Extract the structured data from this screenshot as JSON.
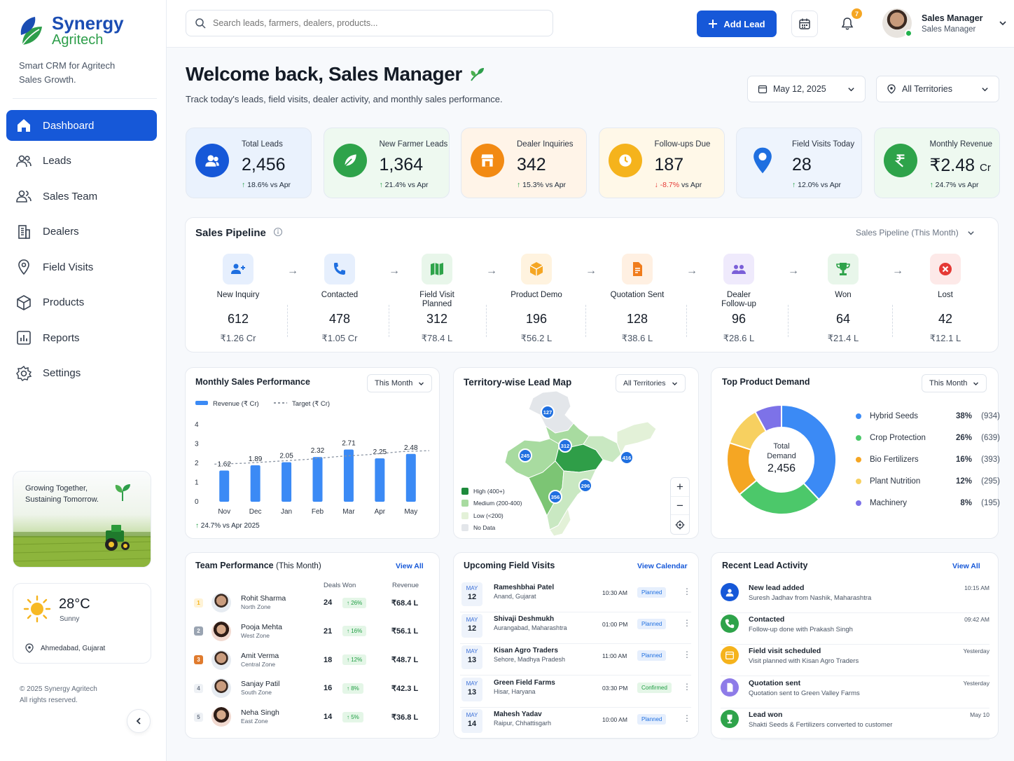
{
  "brand": {
    "name": "Synergy",
    "name2": "Agritech",
    "tagline": "Smart CRM for Agritech Sales Growth."
  },
  "nav": [
    {
      "label": "Dashboard",
      "icon": "home-icon",
      "active": true
    },
    {
      "label": "Leads",
      "icon": "users-icon"
    },
    {
      "label": "Sales Team",
      "icon": "team-icon"
    },
    {
      "label": "Dealers",
      "icon": "building-icon"
    },
    {
      "label": "Field Visits",
      "icon": "location-pin-icon"
    },
    {
      "label": "Products",
      "icon": "box-icon"
    },
    {
      "label": "Reports",
      "icon": "chart-icon"
    },
    {
      "label": "Settings",
      "icon": "gear-icon"
    }
  ],
  "promo": {
    "line1": "Growing Together,",
    "line2": "Sustaining Tomorrow."
  },
  "weather": {
    "temp": "28°C",
    "condition": "Sunny",
    "location": "Ahmedabad, Gujarat"
  },
  "footer": {
    "copyright": "© 2025 Synergy Agritech",
    "rights": "All rights reserved."
  },
  "topbar": {
    "search_placeholder": "Search leads, farmers, dealers, products...",
    "add_lead": "Add Lead",
    "notif_count": "7",
    "user_name": "Sales Manager",
    "user_role": "Sales Manager"
  },
  "header": {
    "title": "Welcome back, Sales Manager",
    "subtitle": "Track today's leads, field visits, dealer activity, and monthly sales performance.",
    "date": "May 12, 2025",
    "territory": "All Territories"
  },
  "kpis": [
    {
      "label": "Total Leads",
      "value": "2,456",
      "delta": "18.6%",
      "dir": "up",
      "vs": "vs Apr",
      "color": "#1658d8",
      "bg": "#eaf2fd",
      "icon": "users-icon"
    },
    {
      "label": "New Farmer Leads",
      "value": "1,364",
      "delta": "21.4%",
      "dir": "up",
      "vs": "vs Apr",
      "color": "#2ea34a",
      "bg": "#eef9f0",
      "icon": "leaf-icon"
    },
    {
      "label": "Dealer Inquiries",
      "value": "342",
      "delta": "15.3%",
      "dir": "up",
      "vs": "vs Apr",
      "color": "#f28a13",
      "bg": "#fff4e8",
      "icon": "store-icon"
    },
    {
      "label": "Follow-ups Due",
      "value": "187",
      "delta": "-8.7%",
      "dir": "down",
      "vs": "vs Apr",
      "color": "#f5b31c",
      "bg": "#fff8e8",
      "icon": "clock-icon"
    },
    {
      "label": "Field Visits Today",
      "value": "28",
      "delta": "12.0%",
      "dir": "up",
      "vs": "vs Apr",
      "color": "#1f6fe0",
      "bg": "#eef4fd",
      "icon": "location-pin-icon"
    },
    {
      "label": "Monthly Revenue",
      "value": "₹2.48",
      "unit": "Cr",
      "delta": "24.7%",
      "dir": "up",
      "vs": "vs Apr",
      "color": "#2ea34a",
      "bg": "#eef9f0",
      "icon": "rupee-icon"
    }
  ],
  "pipeline": {
    "title": "Sales Pipeline",
    "filter": "Sales Pipeline (This Month)",
    "stages": [
      {
        "name": "New Inquiry",
        "count": "612",
        "value": "₹1.26 Cr",
        "color": "#1f6fe0",
        "bg": "#e6effd",
        "icon": "add-user-icon"
      },
      {
        "name": "Contacted",
        "count": "478",
        "value": "₹1.05 Cr",
        "color": "#1f6fe0",
        "bg": "#e6effd",
        "icon": "phone-icon"
      },
      {
        "name": "Field Visit Planned",
        "count": "312",
        "value": "₹78.4 L",
        "color": "#2ea34a",
        "bg": "#e8f6ea",
        "icon": "map-icon"
      },
      {
        "name": "Product Demo",
        "count": "196",
        "value": "₹56.2 L",
        "color": "#f5a623",
        "bg": "#fff3df",
        "icon": "cube-icon"
      },
      {
        "name": "Quotation Sent",
        "count": "128",
        "value": "₹38.6 L",
        "color": "#f07c1c",
        "bg": "#fff0e2",
        "icon": "document-icon"
      },
      {
        "name": "Dealer Follow-up",
        "count": "96",
        "value": "₹28.6 L",
        "color": "#7a5fd8",
        "bg": "#efeafc",
        "icon": "group-icon"
      },
      {
        "name": "Won",
        "count": "64",
        "value": "₹21.4 L",
        "color": "#2ea34a",
        "bg": "#e8f6ea",
        "icon": "trophy-icon"
      },
      {
        "name": "Lost",
        "count": "42",
        "value": "₹12.1 L",
        "color": "#e53935",
        "bg": "#fde9e8",
        "icon": "close-circle-icon"
      }
    ]
  },
  "monthly": {
    "title": "Monthly Sales Performance",
    "filter": "This Month",
    "growth": "24.7% vs Apr 2025"
  },
  "chart_data": {
    "type": "bar",
    "categories": [
      "Nov",
      "Dec",
      "Jan",
      "Feb",
      "Mar",
      "Apr",
      "May"
    ],
    "series": [
      {
        "name": "Revenue (₹ Cr)",
        "values": [
          1.62,
          1.89,
          2.05,
          2.32,
          2.71,
          2.25,
          2.48
        ],
        "labels": [
          "1.62",
          "1.89",
          "2.05",
          "2.32",
          "2.71",
          "2.25",
          "2.48"
        ],
        "color": "#3b8af5"
      },
      {
        "name": "Target (₹ Cr)",
        "values": [
          1.95,
          2.0,
          2.1,
          2.2,
          2.35,
          2.45,
          2.6
        ],
        "style": "dashed",
        "color": "#8a94a3"
      }
    ],
    "yticks": [
      "0",
      "1",
      "2",
      "3",
      "4"
    ],
    "ylim": [
      0,
      4
    ],
    "legend": "top-left"
  },
  "map": {
    "title": "Territory-wise Lead Map",
    "filter": "All Territories",
    "legend": [
      {
        "label": "High (400+)",
        "color": "#1e8a3c"
      },
      {
        "label": "Medium (200-400)",
        "color": "#a8dba0"
      },
      {
        "label": "Low (<200)",
        "color": "#e3f1d8"
      },
      {
        "label": "No Data",
        "color": "#e3e6ea"
      }
    ],
    "markers": [
      "127",
      "312",
      "245",
      "416",
      "296",
      "356"
    ]
  },
  "demand": {
    "title": "Top Product Demand",
    "filter": "This Month",
    "center_label": "Total Demand",
    "center_value": "2,456",
    "items": [
      {
        "name": "Hybrid Seeds",
        "pct": "38%",
        "count": "(934)",
        "color": "#3b8af5",
        "value": 38
      },
      {
        "name": "Crop Protection",
        "pct": "26%",
        "count": "(639)",
        "color": "#4cc86a",
        "value": 26
      },
      {
        "name": "Bio Fertilizers",
        "pct": "16%",
        "count": "(393)",
        "color": "#f5a623",
        "value": 16
      },
      {
        "name": "Plant Nutrition",
        "pct": "12%",
        "count": "(295)",
        "color": "#f7d060",
        "value": 12
      },
      {
        "name": "Machinery",
        "pct": "8%",
        "count": "(195)",
        "color": "#7d72e8",
        "value": 8
      }
    ]
  },
  "team": {
    "title": "Team Performance",
    "period": "(This Month)",
    "view_all": "View All",
    "col_deals": "Deals Won",
    "col_revenue": "Revenue",
    "rows": [
      {
        "rank": "1",
        "name": "Rohit Sharma",
        "zone": "North Zone",
        "deals": "24",
        "pct": "26%",
        "revenue": "₹68.4 L",
        "rank_color": "#f5b31c",
        "rank_bg": "#fff3d6"
      },
      {
        "rank": "2",
        "name": "Pooja Mehta",
        "zone": "West Zone",
        "deals": "21",
        "pct": "16%",
        "revenue": "₹56.1 L",
        "rank_color": "#fff",
        "rank_bg": "#9aa4b2"
      },
      {
        "rank": "3",
        "name": "Amit Verma",
        "zone": "Central Zone",
        "deals": "18",
        "pct": "12%",
        "revenue": "₹48.7 L",
        "rank_color": "#fff",
        "rank_bg": "#e07b2e"
      },
      {
        "rank": "4",
        "name": "Sanjay Patil",
        "zone": "South Zone",
        "deals": "16",
        "pct": "8%",
        "revenue": "₹42.3 L",
        "rank_color": "#6b7584",
        "rank_bg": "#eef1f5"
      },
      {
        "rank": "5",
        "name": "Neha Singh",
        "zone": "East Zone",
        "deals": "14",
        "pct": "5%",
        "revenue": "₹36.8 L",
        "rank_color": "#6b7584",
        "rank_bg": "#eef1f5"
      }
    ]
  },
  "visits": {
    "title": "Upcoming Field Visits",
    "view_all": "View Calendar",
    "rows": [
      {
        "month": "MAY",
        "day": "12",
        "name": "Rameshbhai Patel",
        "loc": "Anand, Gujarat",
        "time": "10:30 AM",
        "status": "Planned"
      },
      {
        "month": "MAY",
        "day": "12",
        "name": "Shivaji Deshmukh",
        "loc": "Aurangabad, Maharashtra",
        "time": "01:00 PM",
        "status": "Planned"
      },
      {
        "month": "MAY",
        "day": "13",
        "name": "Kisan Agro Traders",
        "loc": "Sehore, Madhya Pradesh",
        "time": "11:00 AM",
        "status": "Planned"
      },
      {
        "month": "MAY",
        "day": "13",
        "name": "Green Field Farms",
        "loc": "Hisar, Haryana",
        "time": "03:30 PM",
        "status": "Confirmed"
      },
      {
        "month": "MAY",
        "day": "14",
        "name": "Mahesh Yadav",
        "loc": "Raipur, Chhattisgarh",
        "time": "10:00 AM",
        "status": "Planned"
      }
    ]
  },
  "activity": {
    "title": "Recent Lead Activity",
    "view_all": "View All",
    "rows": [
      {
        "title": "New lead added",
        "desc": "Suresh Jadhav from Nashik, Maharashtra",
        "time": "10:15 AM",
        "color": "#1658d8",
        "icon": "user-icon"
      },
      {
        "title": "Contacted",
        "desc": "Follow-up done with Prakash Singh",
        "time": "09:42 AM",
        "color": "#2ea34a",
        "icon": "phone-icon"
      },
      {
        "title": "Field visit scheduled",
        "desc": "Visit planned with Kisan Agro Traders",
        "time": "Yesterday",
        "color": "#f5b31c",
        "icon": "calendar-icon"
      },
      {
        "title": "Quotation sent",
        "desc": "Quotation sent to Green Valley Farms",
        "time": "Yesterday",
        "color": "#8e7be8",
        "icon": "document-icon"
      },
      {
        "title": "Lead won",
        "desc": "Shakti Seeds & Fertilizers converted to customer",
        "time": "May 10",
        "color": "#2ea34a",
        "icon": "trophy-icon"
      }
    ]
  }
}
